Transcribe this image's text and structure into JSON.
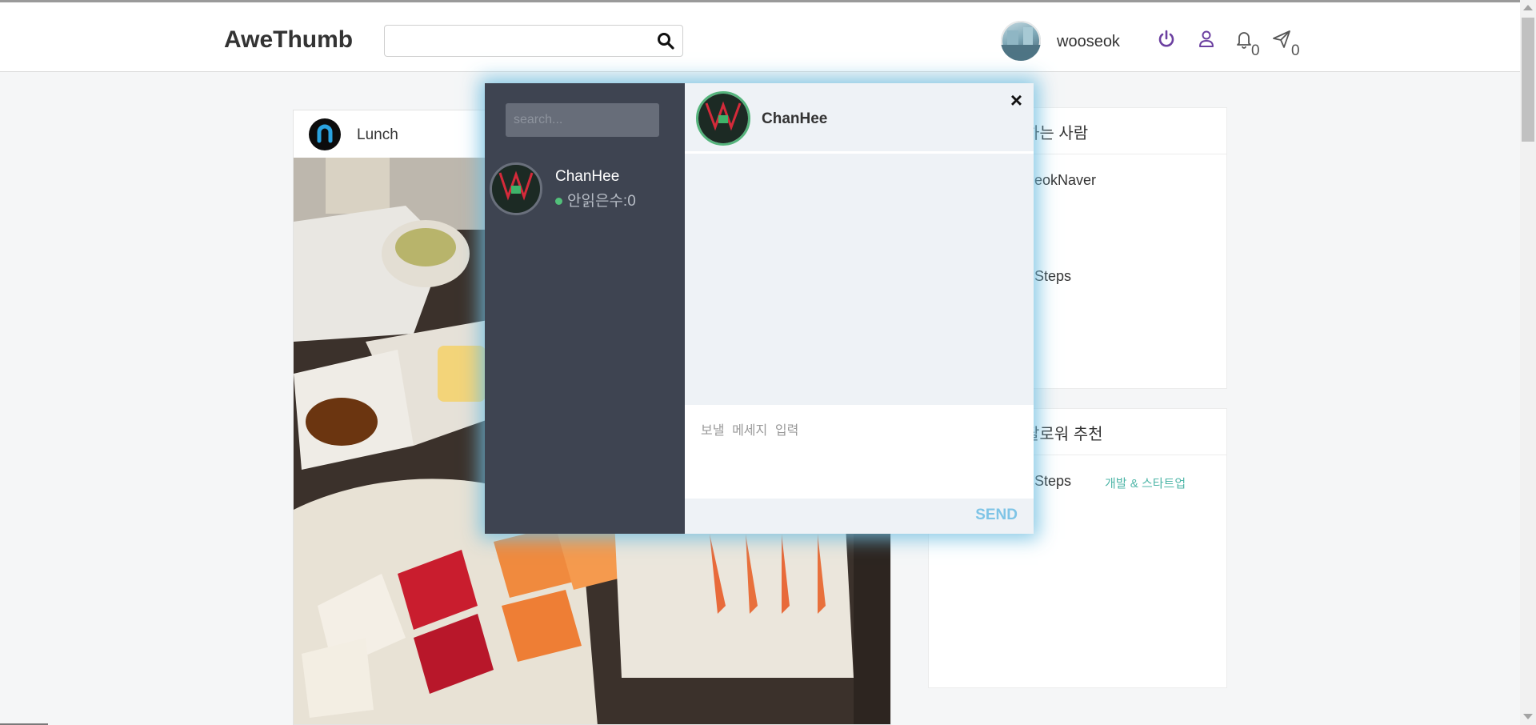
{
  "header": {
    "brand": "AweThumb",
    "search_placeholder": "",
    "username": "wooseok",
    "notifications_count": "0",
    "messages_count": "0"
  },
  "post": {
    "title": "Lunch"
  },
  "side_cards": [
    {
      "title": "하는 사람",
      "items": [
        "eokNaver",
        "Steps"
      ]
    },
    {
      "title": "팔로워 추천",
      "items": [
        "Steps"
      ],
      "tag": "개발 & 스타트업"
    }
  ],
  "chat": {
    "search_placeholder": "search...",
    "contacts": [
      {
        "name": "ChanHee",
        "status": "안읽은수:0",
        "online": true
      }
    ],
    "active_contact": "ChanHee",
    "close_label": "×",
    "input_placeholder": "보낼 메세지 입력",
    "send_label": "SEND"
  },
  "colors": {
    "accent_purple": "#6b3fa0",
    "send_blue": "#7ec4e6",
    "online_green": "#52c07a",
    "chat_sidebar": "#3e4451",
    "tag_teal": "#4fb6a8"
  }
}
